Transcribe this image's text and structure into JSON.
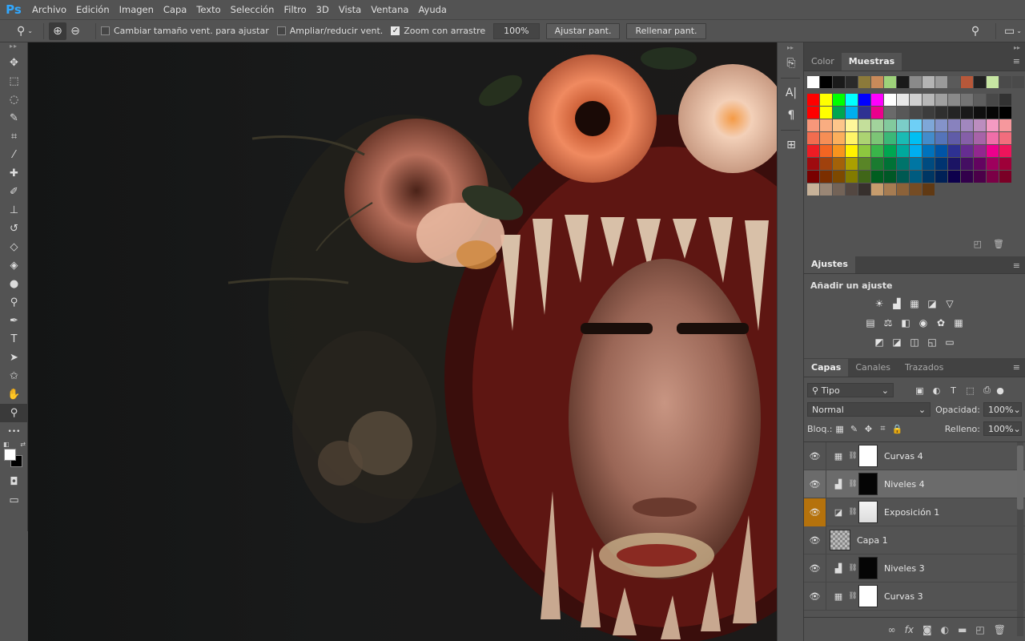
{
  "app": {
    "logo": "Ps"
  },
  "menu": [
    "Archivo",
    "Edición",
    "Imagen",
    "Capa",
    "Texto",
    "Selección",
    "Filtro",
    "3D",
    "Vista",
    "Ventana",
    "Ayuda"
  ],
  "options": {
    "resize_label": "Cambiar tamaño vent. para ajustar",
    "resize_checked": false,
    "zoom_all_label": "Ampliar/reducir vent.",
    "zoom_all_checked": false,
    "scrubby_label": "Zoom con arrastre",
    "scrubby_checked": true,
    "zoom_value": "100%",
    "fit_button": "Ajustar pant.",
    "fill_button": "Rellenar pant."
  },
  "tools": [
    {
      "name": "move-tool",
      "icon": "✥"
    },
    {
      "name": "marquee-tool",
      "icon": "⬚"
    },
    {
      "name": "lasso-tool",
      "icon": "◌"
    },
    {
      "name": "quick-select-tool",
      "icon": "✎"
    },
    {
      "name": "crop-tool",
      "icon": "⌗"
    },
    {
      "name": "eyedropper-tool",
      "icon": "⁄"
    },
    {
      "name": "healing-brush-tool",
      "icon": "✚"
    },
    {
      "name": "brush-tool",
      "icon": "✐"
    },
    {
      "name": "stamp-tool",
      "icon": "⊥"
    },
    {
      "name": "history-brush-tool",
      "icon": "↺"
    },
    {
      "name": "eraser-tool",
      "icon": "◇"
    },
    {
      "name": "bucket-tool",
      "icon": "◈"
    },
    {
      "name": "blur-tool",
      "icon": "●"
    },
    {
      "name": "dodge-tool",
      "icon": "⚲"
    },
    {
      "name": "pen-tool",
      "icon": "✒"
    },
    {
      "name": "type-tool",
      "icon": "T"
    },
    {
      "name": "path-select-tool",
      "icon": "➤"
    },
    {
      "name": "shape-tool",
      "icon": "✩"
    },
    {
      "name": "hand-tool",
      "icon": "✋"
    },
    {
      "name": "zoom-tool",
      "icon": "⚲",
      "active": true
    },
    {
      "name": "more-tools",
      "icon": "•••"
    }
  ],
  "colors": {
    "foreground": "#ffffff",
    "background": "#000000",
    "accent": "#31a8ff",
    "eye_highlight": "#b5720c"
  },
  "swatches_panel": {
    "tabs": [
      "Color",
      "Muestras"
    ],
    "active_tab": "Muestras",
    "recent": [
      "#ffffff",
      "#000000",
      "#1a1a1a",
      "#2a2a2a",
      "#8c7a3a",
      "#c98a5a",
      "#9ed27a",
      "#1a1a1a",
      "#8a8a8a",
      "#b4b4b4",
      "#9a9a9a",
      "#5a5a5a",
      "#b7583a",
      "#222222",
      "#c7e6a3",
      "#4a4a4a",
      "#4a4a4a"
    ],
    "rows": [
      [
        "#ff0000",
        "#ffff00",
        "#00ff00",
        "#00ffff",
        "#0000ff",
        "#ff00ff",
        "#ffffff",
        "#e8e8e8",
        "#d0d0d0",
        "#b8b8b8",
        "#a0a0a0",
        "#8a8a8a",
        "#747474",
        "#5e5e5e",
        "#484848",
        "#323232"
      ],
      [
        "#ff0000",
        "#ffff00",
        "#00a651",
        "#00aeef",
        "#2e3192",
        "#ec008c",
        "#6a6a6a",
        "#585858",
        "#484848",
        "#3c3c3c",
        "#2f2f2f",
        "#242424",
        "#191919",
        "#0f0f0f",
        "#060606",
        "#000000"
      ],
      [
        "#f7977a",
        "#f9ad81",
        "#fdc68a",
        "#fff79a",
        "#c4df9b",
        "#a2d39c",
        "#82ca9d",
        "#7bcdc8",
        "#6ecff6",
        "#7ea7d8",
        "#8493ca",
        "#8882be",
        "#a187be",
        "#bc8dbf",
        "#f49ac2",
        "#f6989d"
      ],
      [
        "#f26c4f",
        "#f68e55",
        "#fbaf5c",
        "#fff467",
        "#acd372",
        "#7cc576",
        "#3bb878",
        "#1abbb4",
        "#00bff3",
        "#438ccb",
        "#5574b9",
        "#605ca8",
        "#855fa8",
        "#a763a8",
        "#f06ea9",
        "#f26d7d"
      ],
      [
        "#ed1c24",
        "#f26522",
        "#f7941d",
        "#fff200",
        "#8dc73f",
        "#39b54a",
        "#00a651",
        "#00a99d",
        "#00aeef",
        "#0072bc",
        "#0054a6",
        "#2e3192",
        "#662d91",
        "#92278f",
        "#ec008c",
        "#ed145b"
      ],
      [
        "#9e0b0f",
        "#a0410d",
        "#a36209",
        "#aba000",
        "#598527",
        "#1a7b30",
        "#007236",
        "#00746b",
        "#0076a3",
        "#004b80",
        "#003471",
        "#1b1464",
        "#440e62",
        "#630460",
        "#9e005d",
        "#9e0039"
      ],
      [
        "#790000",
        "#7b2e00",
        "#7d4900",
        "#827b00",
        "#406618",
        "#005e20",
        "#005826",
        "#005952",
        "#005b7f",
        "#003663",
        "#002157",
        "#0d004c",
        "#32004b",
        "#4b0049",
        "#7b0046",
        "#7a0026"
      ],
      [
        "#c7b299",
        "#998675",
        "#736357",
        "#534741",
        "#37302d",
        "#c69c6d",
        "#a67c52",
        "#8c6239",
        "#754c24",
        "#603913"
      ]
    ]
  },
  "adjustments_panel": {
    "tab": "Ajustes",
    "title": "Añadir un ajuste",
    "rows": [
      [
        {
          "name": "brightness-icon",
          "g": "☀"
        },
        {
          "name": "levels-icon",
          "g": "▟"
        },
        {
          "name": "curves-icon",
          "g": "▦"
        },
        {
          "name": "exposure-icon",
          "g": "◪"
        },
        {
          "name": "vibrance-icon",
          "g": "▽"
        }
      ],
      [
        {
          "name": "hue-sat-icon",
          "g": "▤"
        },
        {
          "name": "color-balance-icon",
          "g": "⚖"
        },
        {
          "name": "bw-icon",
          "g": "◧"
        },
        {
          "name": "photo-filter-icon",
          "g": "◉"
        },
        {
          "name": "channel-mixer-icon",
          "g": "✿"
        },
        {
          "name": "color-lookup-icon",
          "g": "▦"
        }
      ],
      [
        {
          "name": "invert-icon",
          "g": "◩"
        },
        {
          "name": "posterize-icon",
          "g": "◪"
        },
        {
          "name": "threshold-icon",
          "g": "◫"
        },
        {
          "name": "selective-color-icon",
          "g": "◱"
        },
        {
          "name": "gradient-map-icon",
          "g": "▭"
        }
      ]
    ]
  },
  "layers_panel": {
    "tabs": [
      "Capas",
      "Canales",
      "Trazados"
    ],
    "active_tab": "Capas",
    "filter_label": "Tipo",
    "blend_mode": "Normal",
    "opacity_label": "Opacidad:",
    "opacity_value": "100%",
    "lock_label": "Bloq.:",
    "fill_label": "Relleno:",
    "fill_value": "100%",
    "layers": [
      {
        "name": "Curvas 4",
        "type": "curves",
        "thumb": "white",
        "selected": false,
        "eye_highlight": false
      },
      {
        "name": "Niveles 4",
        "type": "levels",
        "thumb": "black",
        "selected": true,
        "eye_highlight": false
      },
      {
        "name": "Exposición 1",
        "type": "exposure",
        "thumb": "ghost",
        "selected": false,
        "eye_highlight": true
      },
      {
        "name": "Capa 1",
        "type": "pixel",
        "thumb": "check",
        "selected": false,
        "eye_highlight": false
      },
      {
        "name": "Niveles 3",
        "type": "levels",
        "thumb": "black",
        "selected": false,
        "eye_highlight": false
      },
      {
        "name": "Curvas 3",
        "type": "curves",
        "thumb": "white",
        "selected": false,
        "eye_highlight": false
      }
    ]
  }
}
